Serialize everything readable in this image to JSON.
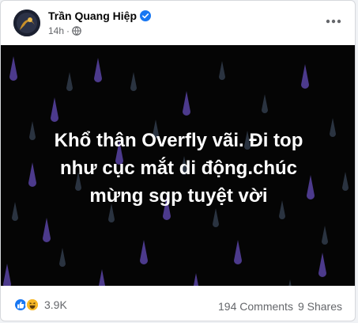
{
  "post": {
    "author": "Trần Quang Hiệp",
    "timestamp": "14h",
    "audience_icon": "globe-icon",
    "verified_icon": "verified-badge-icon",
    "more_icon": "more-horizontal-icon",
    "text_lines": [
      "Khổ thân Overfly vãi. Đi top",
      "như cục mắt di động.chúc",
      "mừng sgp tuyệt vời"
    ],
    "background": "dark-rain-drops",
    "reactions": {
      "icons": [
        "like-icon",
        "haha-icon"
      ],
      "count": "3.9K"
    },
    "comments": "194 Comments",
    "shares": "9 Shares"
  },
  "colors": {
    "accent": "#1877f2",
    "background_dark": "#050505",
    "drop_purple": "#4c3a8c",
    "drop_dark": "#2a3340",
    "text_secondary": "#65676b"
  }
}
